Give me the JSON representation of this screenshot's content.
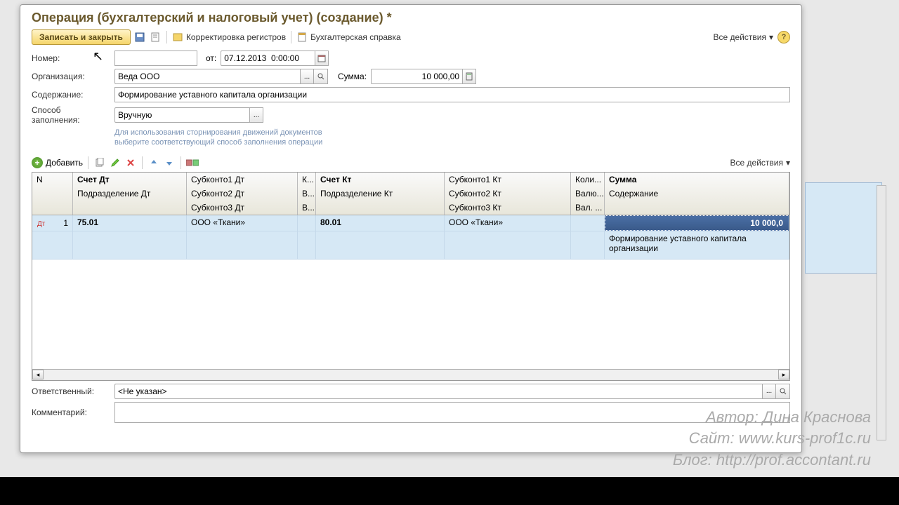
{
  "window_title": "Операция (бухгалтерский и налоговый учет) (создание) *",
  "toolbar": {
    "save_close": "Записать и закрыть",
    "registers": "Корректировка регистров",
    "reference": "Бухгалтерская справка",
    "all_actions": "Все действия"
  },
  "form": {
    "number_label": "Номер:",
    "number_value": "",
    "date_label": "от:",
    "date_value": "07.12.2013  0:00:00",
    "org_label": "Организация:",
    "org_value": "Веда ООО",
    "sum_label": "Сумма:",
    "sum_value": "10 000,00",
    "content_label": "Содержание:",
    "content_value": "Формирование уставного капитала организации",
    "method_label": "Способ заполнения:",
    "method_value": "Вручную",
    "hint1": "Для использования сторнирования движений документов",
    "hint2": "выберите соответствующий способ заполнения операции"
  },
  "grid_toolbar": {
    "add": "Добавить",
    "all_actions": "Все действия"
  },
  "grid": {
    "headers": {
      "n": "N",
      "dt": "Счет Дт",
      "sub1dt": "Субконто1 Дт",
      "k": "К...",
      "kt": "Счет Кт",
      "sub1kt": "Субконто1 Кт",
      "kol": "Коли...",
      "sum": "Сумма",
      "podr_dt": "Подразделение Дт",
      "sub2dt": "Субконто2 Дт",
      "v1": "В...",
      "podr_kt": "Подразделение Кт",
      "sub2kt": "Субконто2 Кт",
      "val1": "Валю...",
      "content": "Содержание",
      "sub3dt": "Субконто3 Дт",
      "v2": "В...",
      "sub3kt": "Субконто3 Кт",
      "val2": "Вал. ..."
    },
    "row": {
      "n": "1",
      "dt": "75.01",
      "sub1dt": "ООО «Ткани»",
      "kt": "80.01",
      "sub1kt": "ООО «Ткани»",
      "sum": "10 000,0",
      "content": "Формирование уставного капитала организации"
    }
  },
  "bottom": {
    "resp_label": "Ответственный:",
    "resp_value": "<Не указан>",
    "comment_label": "Комментарий:",
    "comment_value": ""
  },
  "watermark": {
    "l1": "Автор: Дина Краснова",
    "l2": "Сайт: www.kurs-prof1c.ru",
    "l3": "Блог: http://prof.accontant.ru"
  }
}
